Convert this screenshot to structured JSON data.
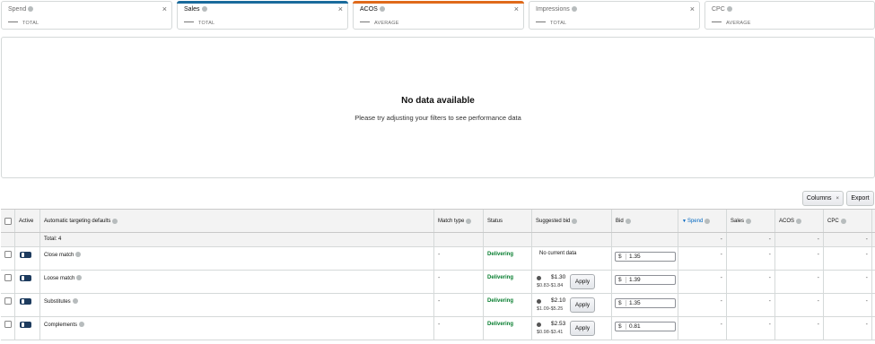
{
  "metrics": [
    {
      "label": "Spend",
      "aggregate": "TOTAL",
      "color": "",
      "active": false
    },
    {
      "label": "Sales",
      "aggregate": "TOTAL",
      "color": "#1a6b9c",
      "active": true
    },
    {
      "label": "ACOS",
      "aggregate": "AVERAGE",
      "color": "#e06a1b",
      "active": true
    },
    {
      "label": "Impressions",
      "aggregate": "TOTAL",
      "color": "",
      "active": false
    },
    {
      "label": "CPC",
      "aggregate": "AVERAGE",
      "color": "",
      "active": false
    }
  ],
  "chart": {
    "title": "No data available",
    "subtitle": "Please try adjusting your filters to see performance data"
  },
  "toolbar": {
    "columns_label": "Columns",
    "export_label": "Export"
  },
  "table": {
    "headers": {
      "active": "Active",
      "targeting": "Automatic targeting defaults",
      "match_type": "Match type",
      "status": "Status",
      "suggested_bid": "Suggested bid",
      "bid": "Bid",
      "spend": "Spend",
      "sales": "Sales",
      "acos": "ACOS",
      "cpc": "CPC"
    },
    "total_label": "Total: 4",
    "dash": "-",
    "currency": "$",
    "rows": [
      {
        "name": "Close match",
        "match_type": "-",
        "status": "Delivering",
        "suggested": "No current data",
        "price": "",
        "range": "",
        "apply": "",
        "bid": "1.35"
      },
      {
        "name": "Loose match",
        "match_type": "-",
        "status": "Delivering",
        "suggested": "",
        "price": "$1.30",
        "range": "$0.83-$1.84",
        "apply": "Apply",
        "bid": "1.39"
      },
      {
        "name": "Substitutes",
        "match_type": "-",
        "status": "Delivering",
        "suggested": "",
        "price": "$2.10",
        "range": "$1.09-$5.25",
        "apply": "Apply",
        "bid": "1.35"
      },
      {
        "name": "Complements",
        "match_type": "-",
        "status": "Delivering",
        "suggested": "",
        "price": "$2.53",
        "range": "$0.98-$3.41",
        "apply": "Apply",
        "bid": "0.81"
      }
    ]
  },
  "colors": {
    "delivering": "#067d2e",
    "toggle_on": "#1d3b5e",
    "link": "#0066c0"
  }
}
